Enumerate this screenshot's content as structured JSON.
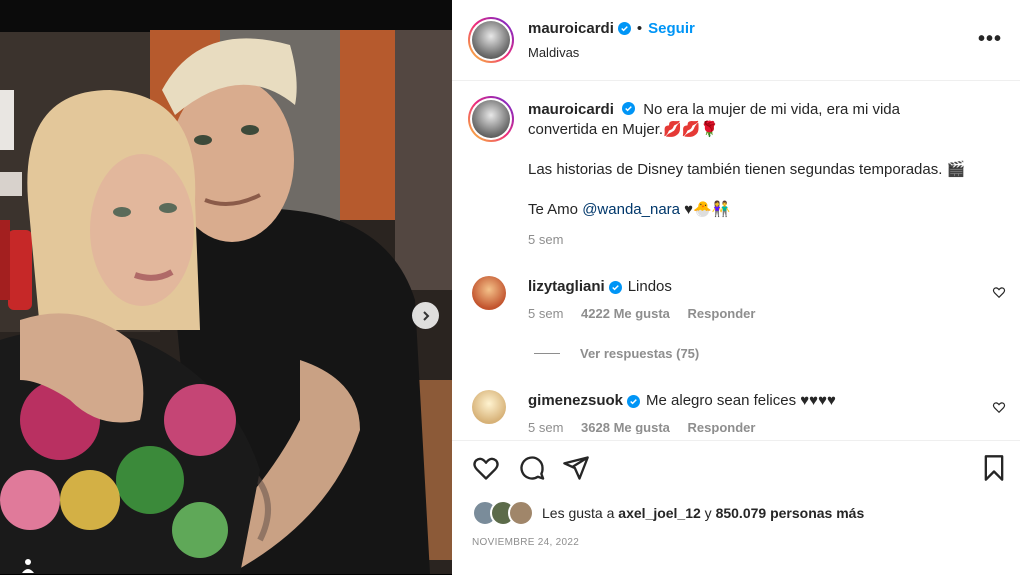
{
  "post": {
    "username": "mauroicardi",
    "follow_label": "Seguir",
    "location": "Maldivas",
    "more_label": "•••",
    "caption_line1": "No era la mujer de mi vida, era mi vida",
    "caption_line2": "convertida en Mujer.💋💋🌹",
    "caption_line3": "Las historias de Disney también tienen segundas temporadas. 🎬",
    "caption_prefix4": "Te Amo ",
    "caption_mention": "@wanda_nara",
    "caption_suffix4": " ♥🐣👫",
    "caption_time": "5 sem"
  },
  "comments": [
    {
      "username": "lizytagliani",
      "text": "Lindos",
      "time": "5 sem",
      "likes": "4222 Me gusta",
      "reply_label": "Responder",
      "view_replies": "Ver respuestas (75)"
    },
    {
      "username": "gimenezsuok",
      "text": "Me alegro sean felices ♥♥♥♥",
      "time": "5 sem",
      "likes": "3628 Me gusta",
      "reply_label": "Responder"
    }
  ],
  "likes": {
    "prefix": "Les gusta a ",
    "user": "axel_joel_12",
    "middle": " y ",
    "count": "850.079 personas más"
  },
  "date": "NOVIEMBRE 24, 2022",
  "colors": {
    "accent": "#0095f6",
    "verified": "#0095f6",
    "text": "#262626",
    "muted": "#8e8e8e"
  },
  "icons": [
    "heart-icon",
    "comment-icon",
    "share-icon",
    "bookmark-icon",
    "verified-icon",
    "chevron-right-icon",
    "more-icon",
    "user-tag-icon"
  ]
}
